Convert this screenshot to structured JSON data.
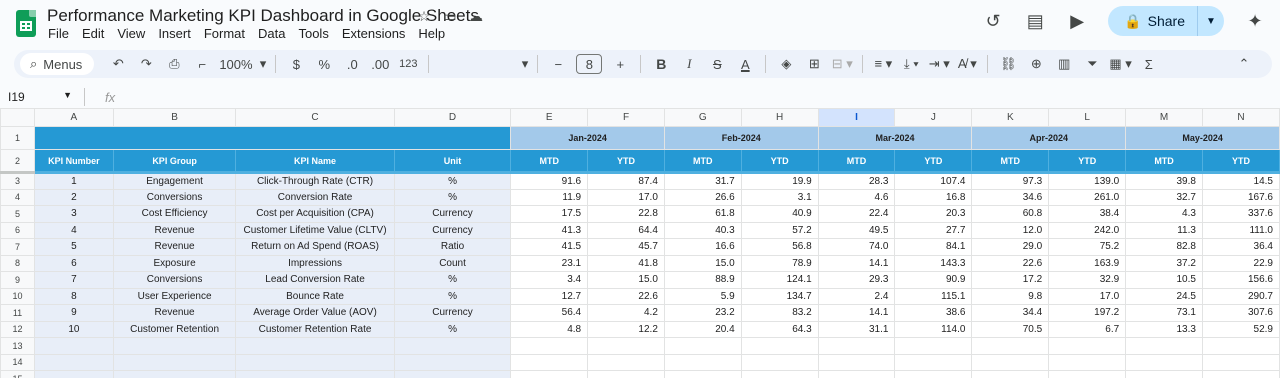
{
  "app": {
    "title": "Performance Marketing KPI Dashboard in Google Sheets",
    "menu": [
      "File",
      "Edit",
      "View",
      "Insert",
      "Format",
      "Data",
      "Tools",
      "Extensions",
      "Help"
    ],
    "share_label": "Share",
    "brand_color": "#0f9d58",
    "accent": "#c2e7ff"
  },
  "toolbar": {
    "menus_label": "Menus",
    "zoom": "100%",
    "currency": "$",
    "percent": "%",
    "decrease_decimal": ".0",
    "increase_decimal": ".00",
    "number_format": "123",
    "font_size": "8",
    "bold": "B"
  },
  "formula": {
    "cell_ref": "I19",
    "fx": "fx",
    "value": ""
  },
  "grid": {
    "columns": [
      "",
      "A",
      "B",
      "C",
      "D",
      "E",
      "F",
      "G",
      "H",
      "I",
      "J",
      "K",
      "L",
      "M",
      "N"
    ],
    "selected_column": "I",
    "months": [
      "Jan-2024",
      "Feb-2024",
      "Mar-2024",
      "Apr-2024",
      "May-2024"
    ],
    "headers": [
      "KPI Number",
      "KPI Group",
      "KPI Name",
      "Unit",
      "MTD",
      "YTD",
      "MTD",
      "YTD",
      "MTD",
      "YTD",
      "MTD",
      "YTD",
      "MTD",
      "YTD"
    ],
    "header_color": "#2599d4",
    "month_color": "#a3c9ea",
    "rows": [
      {
        "n": "3",
        "cells": [
          "1",
          "Engagement",
          "Click-Through Rate (CTR)",
          "%",
          "91.6",
          "87.4",
          "31.7",
          "19.9",
          "28.3",
          "107.4",
          "97.3",
          "139.0",
          "39.8",
          "14.5"
        ]
      },
      {
        "n": "4",
        "cells": [
          "2",
          "Conversions",
          "Conversion Rate",
          "%",
          "11.9",
          "17.0",
          "26.6",
          "3.1",
          "4.6",
          "16.8",
          "34.6",
          "261.0",
          "32.7",
          "167.6"
        ]
      },
      {
        "n": "5",
        "cells": [
          "3",
          "Cost Efficiency",
          "Cost per Acquisition (CPA)",
          "Currency",
          "17.5",
          "22.8",
          "61.8",
          "40.9",
          "22.4",
          "20.3",
          "60.8",
          "38.4",
          "4.3",
          "337.6"
        ]
      },
      {
        "n": "6",
        "cells": [
          "4",
          "Revenue",
          "Customer Lifetime Value (CLTV)",
          "Currency",
          "41.3",
          "64.4",
          "40.3",
          "57.2",
          "49.5",
          "27.7",
          "12.0",
          "242.0",
          "11.3",
          "111.0"
        ]
      },
      {
        "n": "7",
        "cells": [
          "5",
          "Revenue",
          "Return on Ad Spend (ROAS)",
          "Ratio",
          "41.5",
          "45.7",
          "16.6",
          "56.8",
          "74.0",
          "84.1",
          "29.0",
          "75.2",
          "82.8",
          "36.4"
        ]
      },
      {
        "n": "8",
        "cells": [
          "6",
          "Exposure",
          "Impressions",
          "Count",
          "23.1",
          "41.8",
          "15.0",
          "78.9",
          "14.1",
          "143.3",
          "22.6",
          "163.9",
          "37.2",
          "22.9"
        ]
      },
      {
        "n": "9",
        "cells": [
          "7",
          "Conversions",
          "Lead Conversion Rate",
          "%",
          "3.4",
          "15.0",
          "88.9",
          "124.1",
          "29.3",
          "90.9",
          "17.2",
          "32.9",
          "10.5",
          "156.6"
        ]
      },
      {
        "n": "10",
        "cells": [
          "8",
          "User Experience",
          "Bounce Rate",
          "%",
          "12.7",
          "22.6",
          "5.9",
          "134.7",
          "2.4",
          "115.1",
          "9.8",
          "17.0",
          "24.5",
          "290.7"
        ]
      },
      {
        "n": "11",
        "cells": [
          "9",
          "Revenue",
          "Average Order Value (AOV)",
          "Currency",
          "56.4",
          "4.2",
          "23.2",
          "83.2",
          "14.1",
          "38.6",
          "34.4",
          "197.2",
          "73.1",
          "307.6"
        ]
      },
      {
        "n": "12",
        "cells": [
          "10",
          "Customer Retention",
          "Customer Retention Rate",
          "%",
          "4.8",
          "12.2",
          "20.4",
          "64.3",
          "31.1",
          "114.0",
          "70.5",
          "6.7",
          "13.3",
          "52.9"
        ]
      }
    ],
    "empty_rows": [
      "13",
      "14",
      "15"
    ]
  }
}
